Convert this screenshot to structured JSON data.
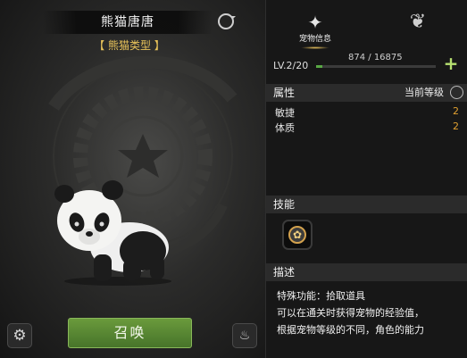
{
  "preview": {
    "pet_name": "熊猫唐唐",
    "pet_type": "【 熊猫类型 】",
    "summon_label": "召唤",
    "settings_icon": "gear-icon",
    "recall_icon": "dismiss-pet-icon",
    "refresh_icon": "refresh-icon"
  },
  "tabs": [
    {
      "label": "宠物信息",
      "icon": "fox-head-icon",
      "active": true
    },
    {
      "label": "",
      "icon": "bow-icon",
      "active": false
    }
  ],
  "level": {
    "text": "LV.2/20",
    "exp_text": "874 / 16875",
    "exp_fraction": 0.052,
    "add_icon": "plus-icon"
  },
  "attributes": {
    "header": "属性",
    "mode_label": "当前等级",
    "stats": [
      {
        "name": "敏捷",
        "value": "2"
      },
      {
        "name": "体质",
        "value": "2"
      }
    ]
  },
  "skills": {
    "header": "技能",
    "icon": "paw-icon"
  },
  "description": {
    "header": "描述",
    "lines": [
      "特殊功能：拾取道具",
      "可以在通关时获得宠物的经验值，",
      "根据宠物等级的不同，角色的能力"
    ]
  },
  "colors": {
    "accent_gold": "#e8c35a",
    "stat_value": "#e0a030",
    "summon_green": "#5a8a34",
    "exp_green": "#59a845"
  }
}
